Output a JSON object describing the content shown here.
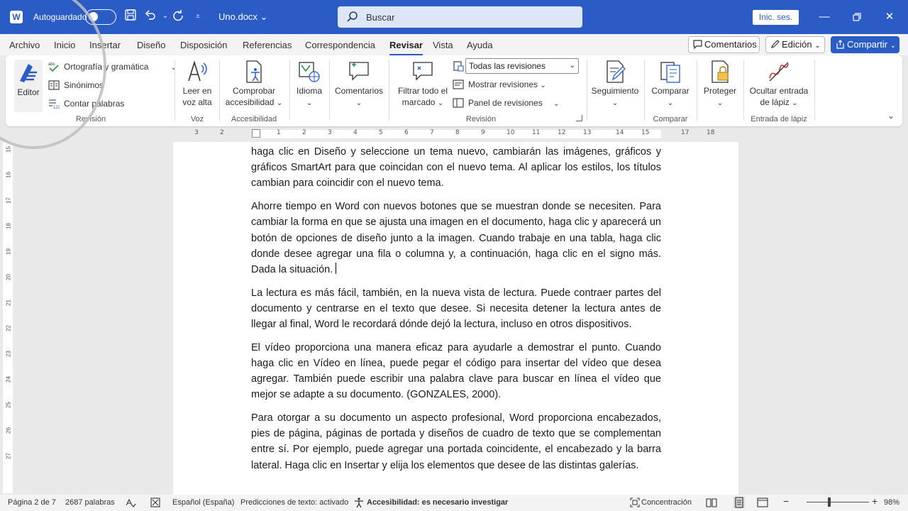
{
  "titlebar": {
    "autosave_label": "Autoguardado",
    "doc_name": "Uno.docx",
    "search_placeholder": "Buscar",
    "signin_label": "Inic. ses."
  },
  "tabs": [
    "Archivo",
    "Inicio",
    "Insertar",
    "Diseño",
    "Disposición",
    "Referencias",
    "Correspondencia",
    "Revisar",
    "Vista",
    "Ayuda"
  ],
  "active_tab": "Revisar",
  "top_buttons": {
    "comments": "Comentarios",
    "editing": "Edición",
    "share": "Compartir"
  },
  "ribbon": {
    "editor": "Editor",
    "spelling": "Ortografía y gramática",
    "thesaurus": "Sinónimos",
    "word_count": "Contar palabras",
    "group_revision": "Revisión",
    "read_aloud_1": "Leer en",
    "read_aloud_2": "voz alta",
    "group_voice": "Voz",
    "check_acc_1": "Comprobar",
    "check_acc_2": "accesibilidad",
    "group_acc": "Accesibilidad",
    "language": "Idioma",
    "comments": "Comentarios",
    "filter_1": "Filtrar todo el",
    "filter_2": "marcado",
    "all_revisions": "Todas las revisiones",
    "show_revisions": "Mostrar revisiones",
    "revisions_panel": "Panel de revisiones",
    "group_revision2": "Revisión",
    "tracking": "Seguimiento",
    "compare": "Comparar",
    "group_compare": "Comparar",
    "protect": "Proteger",
    "hide_ink_1": "Ocultar entrada",
    "hide_ink_2": "de lápiz",
    "group_ink": "Entrada de lápiz"
  },
  "ruler_ticks": [
    "3",
    "2",
    "1",
    "1",
    "2",
    "3",
    "4",
    "5",
    "6",
    "7",
    "8",
    "9",
    "10",
    "11",
    "12",
    "13",
    "14",
    "15",
    "17",
    "18"
  ],
  "vruler_ticks": [
    "15",
    "16",
    "17",
    "18",
    "19",
    "20",
    "21",
    "22",
    "23",
    "24",
    "25",
    "26",
    "27"
  ],
  "document": {
    "p1": "haga clic en Diseño y seleccione un tema nuevo, cambiarán las imágenes, gráficos y gráficos SmartArt para que coincidan con el nuevo tema. Al aplicar los estilos, los títulos cambian para coincidir con el nuevo tema.",
    "p2": "Ahorre tiempo en Word con nuevos botones que se muestran donde se necesiten. Para cambiar la forma en que se ajusta una imagen en el documento, haga clic y aparecerá un botón de opciones de diseño junto a la imagen. Cuando trabaje en una tabla, haga clic donde desee agregar una fila o columna y, a continuación, haga clic en el signo más. Dada la situación.",
    "p3": "La lectura es más fácil, también, en la nueva vista de lectura. Puede contraer partes del documento y centrarse en el texto que desee. Si necesita detener la lectura antes de llegar al final, Word le recordará dónde dejó la lectura, incluso en otros dispositivos.",
    "p4": "El vídeo proporciona una manera eficaz para ayudarle a demostrar el punto. Cuando haga clic en Vídeo en línea, puede pegar el código para insertar del vídeo que desea agregar. También puede escribir una palabra clave para buscar en línea el vídeo que mejor se adapte a su documento. (GONZALES, 2000).",
    "p5": "Para otorgar a su documento un aspecto profesional, Word proporciona encabezados, pies de página, páginas de portada y diseños de cuadro de texto que se complementan entre sí. Por ejemplo, puede agregar una portada coincidente, el encabezado y la barra lateral. Haga clic en Insertar y elija los elementos que desee de las distintas galerías."
  },
  "status": {
    "page": "Página 2 de 7",
    "words": "2687 palabras",
    "language": "Español (España)",
    "predictions": "Predicciones de texto: activado",
    "accessibility": "Accesibilidad: es necesario investigar",
    "focus": "Concentración",
    "zoom": "98%"
  },
  "colors": {
    "accent": "#2b5cc6"
  }
}
